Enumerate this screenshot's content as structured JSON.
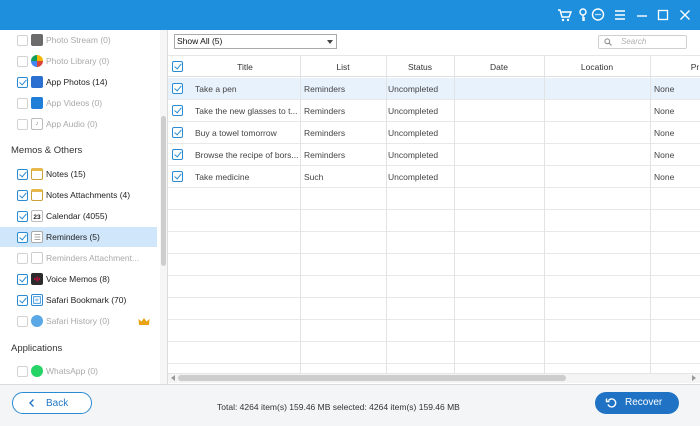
{
  "titlebar": {
    "icons": [
      "cart-icon",
      "key-icon",
      "chat-icon",
      "menu-icon",
      "minimize-icon",
      "maximize-icon",
      "close-icon"
    ],
    "color": "#1e8fdc"
  },
  "sidebar": {
    "items_top": [
      {
        "label": "Photo Stream (0)",
        "checked": false,
        "dim": true,
        "icon": "photo-stream-icon"
      },
      {
        "label": "Photo Library (0)",
        "checked": false,
        "dim": true,
        "icon": "photo-library-icon"
      },
      {
        "label": "App Photos (14)",
        "checked": true,
        "dim": false,
        "icon": "app-photos-icon"
      },
      {
        "label": "App Videos (0)",
        "checked": false,
        "dim": true,
        "icon": "app-videos-icon"
      },
      {
        "label": "App Audio (0)",
        "checked": false,
        "dim": true,
        "icon": "app-audio-icon"
      }
    ],
    "section_memos": "Memos & Others",
    "items_memos": [
      {
        "label": "Notes (15)",
        "checked": true,
        "dim": false,
        "icon": "notes-icon"
      },
      {
        "label": "Notes Attachments (4)",
        "checked": true,
        "dim": false,
        "icon": "notes-attachments-icon"
      },
      {
        "label": "Calendar (4055)",
        "checked": true,
        "dim": false,
        "icon": "calendar-icon",
        "badge": "23"
      },
      {
        "label": "Reminders (5)",
        "checked": true,
        "dim": false,
        "icon": "reminders-icon",
        "selected": true
      },
      {
        "label": "Reminders Attachment...",
        "checked": false,
        "dim": true,
        "icon": "reminders-attachments-icon"
      },
      {
        "label": "Voice Memos (8)",
        "checked": true,
        "dim": false,
        "icon": "voice-memos-icon"
      },
      {
        "label": "Safari Bookmark (70)",
        "checked": true,
        "dim": false,
        "icon": "safari-bookmark-icon"
      },
      {
        "label": "Safari History (0)",
        "checked": false,
        "dim": true,
        "icon": "safari-history-icon",
        "premium": true
      }
    ],
    "section_apps": "Applications",
    "items_apps": [
      {
        "label": "WhatsApp (0)",
        "checked": false,
        "dim": true,
        "icon": "whatsapp-icon"
      }
    ]
  },
  "toolbar": {
    "filter_value": "Show All (5)",
    "search_placeholder": "Search"
  },
  "table": {
    "columns": [
      "Title",
      "List",
      "Status",
      "Date",
      "Location",
      "Pr"
    ],
    "rows": [
      {
        "title": "Take a pen",
        "list": "Reminders",
        "status": "Uncompleted",
        "date": "",
        "location": "",
        "priority": "None",
        "selected": true
      },
      {
        "title": "Take the new glasses to t...",
        "list": "Reminders",
        "status": "Uncompleted",
        "date": "",
        "location": "",
        "priority": "None"
      },
      {
        "title": "Buy a towel tomorrow",
        "list": "Reminders",
        "status": "Uncompleted",
        "date": "",
        "location": "",
        "priority": "None"
      },
      {
        "title": "Browse the recipe of bors...",
        "list": "Reminders",
        "status": "Uncompleted",
        "date": "",
        "location": "",
        "priority": "None"
      },
      {
        "title": "Take medicine",
        "list": "Such",
        "status": "Uncompleted",
        "date": "",
        "location": "",
        "priority": "None"
      }
    ]
  },
  "footer": {
    "back_label": "Back",
    "totals": "Total: 4264 item(s) 159.46 MB   selected: 4264 item(s) 159.46 MB",
    "recover_label": "Recover"
  },
  "colors": {
    "accent": "#2a8bd3",
    "recover_button": "#2073c4",
    "selected_row": "#e8f2fc",
    "selected_sidebar": "#cfe6fb"
  }
}
